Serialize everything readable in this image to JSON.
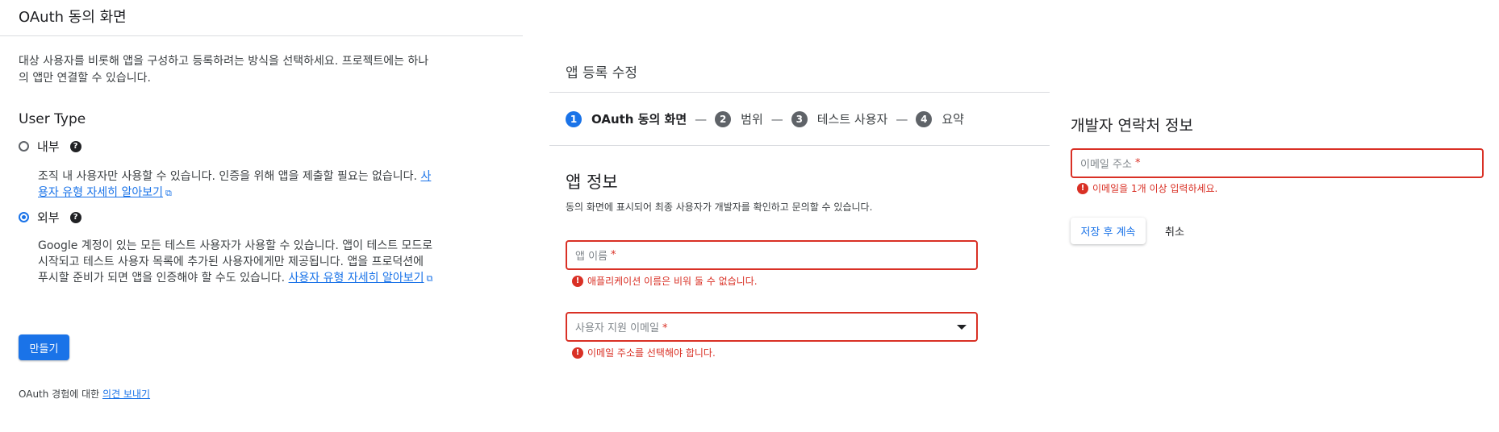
{
  "left": {
    "title": "OAuth 동의 화면",
    "description": "대상 사용자를 비롯해 앱을 구성하고 등록하려는 방식을 선택하세요. 프로젝트에는 하나의 앱만 연결할 수 있습니다.",
    "user_type_label": "User Type",
    "internal": {
      "label": "내부",
      "selected": false,
      "description": "조직 내 사용자만 사용할 수 있습니다. 인증을 위해 앱을 제출할 필요는 없습니다.",
      "link": "사용자 유형 자세히 알아보기"
    },
    "external": {
      "label": "외부",
      "selected": true,
      "description": "Google 계정이 있는 모든 테스트 사용자가 사용할 수 있습니다. 앱이 테스트 모드로 시작되고 테스트 사용자 목록에 추가된 사용자에게만 제공됩니다. 앱을 프로덕션에 푸시할 준비가 되면 앱을 인증해야 할 수도 있습니다.",
      "link": "사용자 유형 자세히 알아보기"
    },
    "create_button": "만들기",
    "feedback_prefix": "OAuth 경험에 대한",
    "feedback_link": "의견 보내기"
  },
  "middle": {
    "title": "앱 등록 수정",
    "steps": [
      {
        "num": "1",
        "label": "OAuth 동의 화면",
        "active": true
      },
      {
        "num": "2",
        "label": "범위",
        "active": false
      },
      {
        "num": "3",
        "label": "테스트 사용자",
        "active": false
      },
      {
        "num": "4",
        "label": "요약",
        "active": false
      }
    ],
    "step_separator": "—",
    "app_info_title": "앱 정보",
    "app_info_desc": "동의 화면에 표시되어 최종 사용자가 개발자를 확인하고 문의할 수 있습니다.",
    "app_name_label": "앱 이름",
    "app_name_error": "애플리케이션 이름은 비워 둘 수 없습니다.",
    "support_email_label": "사용자 지원 이메일",
    "support_email_error": "이메일 주소를 선택해야 합니다.",
    "required_mark": "*"
  },
  "right": {
    "title": "개발자 연락처 정보",
    "email_label": "이메일 주소",
    "email_error": "이메일을 1개 이상 입력하세요.",
    "save_button": "저장 후 계속",
    "cancel_button": "취소"
  },
  "colors": {
    "accent": "#1a73e8",
    "error": "#d93025",
    "text": "#202124",
    "divider": "#dadce0"
  },
  "icons": {
    "help": "?",
    "error": "!",
    "external_link": "⧉"
  }
}
